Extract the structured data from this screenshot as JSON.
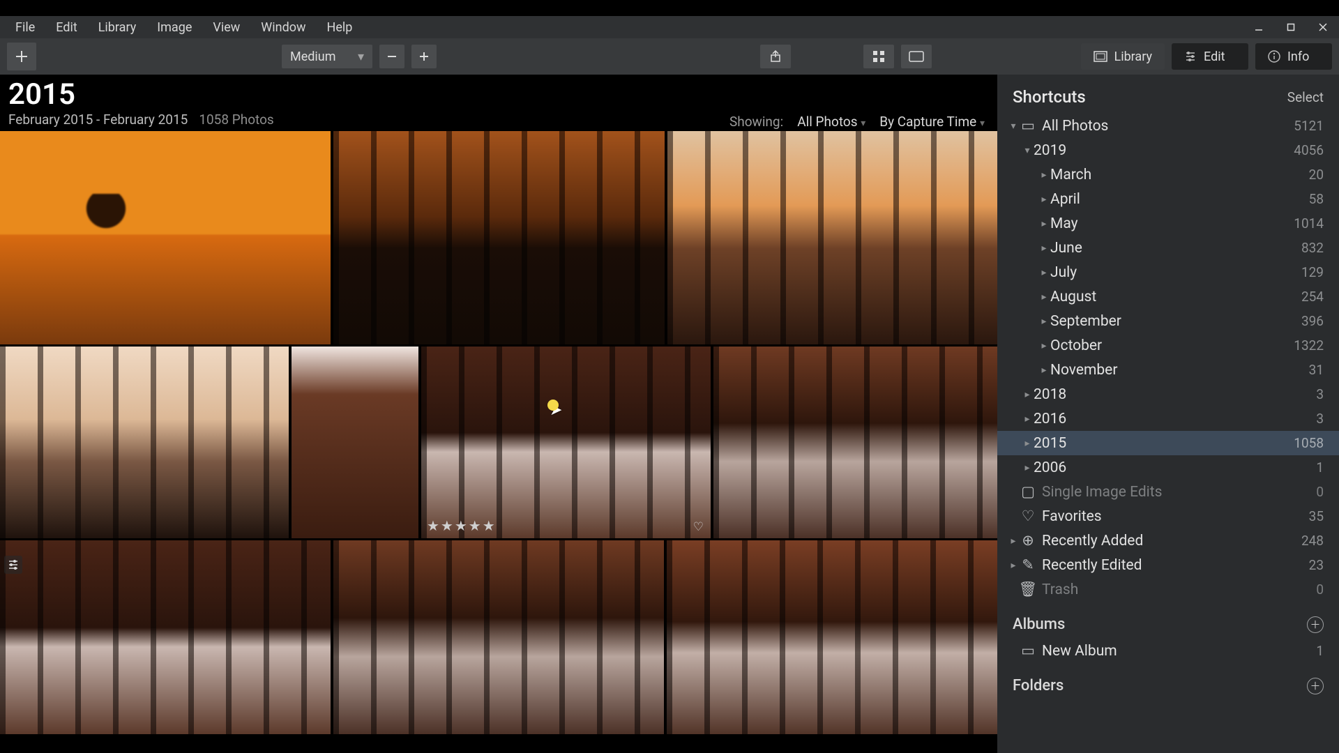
{
  "menu": {
    "items": [
      "File",
      "Edit",
      "Library",
      "Image",
      "View",
      "Window",
      "Help"
    ]
  },
  "toolbar": {
    "size_label": "Medium"
  },
  "mode_tabs": {
    "library": "Library",
    "edit": "Edit",
    "info": "Info"
  },
  "gallery": {
    "title": "2015",
    "date_range": "February 2015 - February 2015",
    "count_text": "1058 Photos",
    "showing_label": "Showing:",
    "filter_value": "All Photos",
    "sort_value": "By Capture Time",
    "stars": "★★★★★"
  },
  "sidebar": {
    "shortcuts_title": "Shortcuts",
    "select_label": "Select",
    "albums_title": "Albums",
    "folders_title": "Folders",
    "tree": {
      "all_photos": {
        "label": "All Photos",
        "count": "5121"
      },
      "year_2019": {
        "label": "2019",
        "count": "4056"
      },
      "months": [
        {
          "label": "March",
          "count": "20"
        },
        {
          "label": "April",
          "count": "58"
        },
        {
          "label": "May",
          "count": "1014"
        },
        {
          "label": "June",
          "count": "832"
        },
        {
          "label": "July",
          "count": "129"
        },
        {
          "label": "August",
          "count": "254"
        },
        {
          "label": "September",
          "count": "396"
        },
        {
          "label": "October",
          "count": "1322"
        },
        {
          "label": "November",
          "count": "31"
        }
      ],
      "year_2018": {
        "label": "2018",
        "count": "3"
      },
      "year_2016": {
        "label": "2016",
        "count": "3"
      },
      "year_2015": {
        "label": "2015",
        "count": "1058"
      },
      "year_2006": {
        "label": "2006",
        "count": "1"
      },
      "single_edits": {
        "label": "Single Image Edits",
        "count": "0"
      },
      "favorites": {
        "label": "Favorites",
        "count": "35"
      },
      "recently_added": {
        "label": "Recently Added",
        "count": "248"
      },
      "recently_edited": {
        "label": "Recently Edited",
        "count": "23"
      },
      "trash": {
        "label": "Trash",
        "count": "0"
      },
      "new_album": {
        "label": "New Album",
        "count": "1"
      }
    }
  }
}
